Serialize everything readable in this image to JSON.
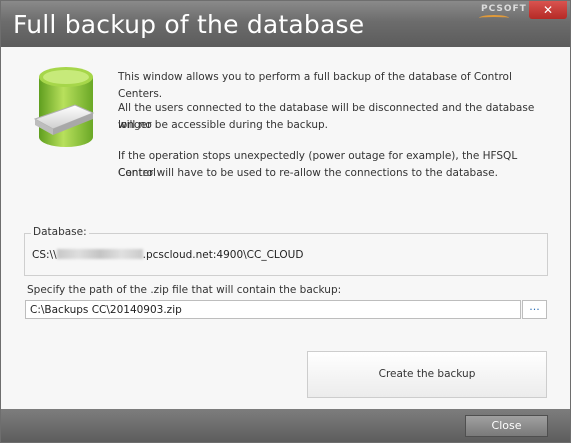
{
  "window": {
    "title": "Full backup of the database",
    "brand": "PCSOFT",
    "close_glyph": "✕"
  },
  "intro": {
    "line1": "This window allows you to perform a full backup of the database of Control Centers.",
    "line2a": "All the users connected to the database will be disconnected and the database will no",
    "line2b": "longer be accessible during the backup.",
    "line3a": "If the operation stops unexpectedly (power outage for example), the HFSQL Control",
    "line3b": "Center will have to be used to re-allow the connections to the database."
  },
  "database": {
    "legend": "Database:",
    "prefix": "CS:\\\\",
    "suffix": ".pcscloud.net:4900\\CC_CLOUD"
  },
  "backup_path": {
    "label": "Specify the path of the .zip file that will contain the backup:",
    "value": "C:\\Backups CC\\20140903.zip",
    "browse_label": "..."
  },
  "actions": {
    "create_label": "Create the backup",
    "close_label": "Close"
  },
  "icons": {
    "db": "database-backup-icon"
  },
  "colors": {
    "titlebar": "#6c6c6c",
    "close_red": "#c9302c",
    "db_green": "#8dc63f"
  }
}
